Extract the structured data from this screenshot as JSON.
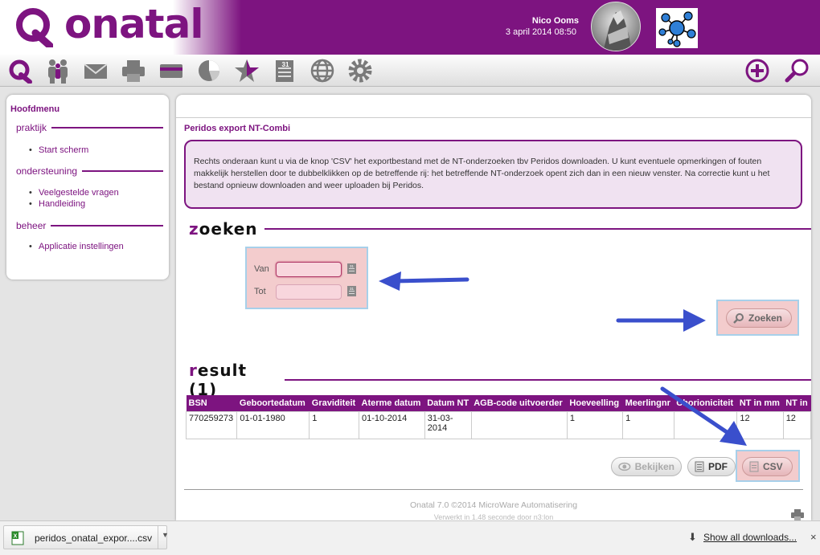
{
  "header": {
    "logo_text": "onatal",
    "user_name": "Nico Ooms",
    "datetime": "3 april 2014 08:50"
  },
  "toolbar": {
    "icons": [
      "onatal-home-icon",
      "patients-icon",
      "mail-icon",
      "print-icon",
      "card-icon",
      "chart-icon",
      "favorites-icon",
      "calendar-icon",
      "globe-icon",
      "settings-icon",
      "add-icon",
      "search-icon"
    ],
    "calendar_day": "31"
  },
  "sidebar": {
    "title": "Hoofdmenu",
    "sections": [
      {
        "label": "praktijk",
        "items": [
          "Start scherm"
        ]
      },
      {
        "label": "ondersteuning",
        "items": [
          "Veelgestelde vragen",
          "Handleiding"
        ]
      },
      {
        "label": "beheer",
        "items": [
          "Applicatie instellingen"
        ]
      }
    ]
  },
  "main": {
    "title": "Peridos export NT-Combi",
    "info": "Rechts onderaan kunt u via de knop 'CSV' het exportbestand met de NT-onderzoeken tbv Peridos downloaden. U kunt eventuele opmerkingen of fouten makkelijk herstellen door te dubbelklikken op de betreffende rij: het betreffende NT-onderzoek opent zich dan in een nieuw venster. Na correctie kunt u het bestand opnieuw downloaden and weer uploaden bij Peridos."
  },
  "search": {
    "heading_first": "z",
    "heading_rest": "oeken",
    "van_label": "Van",
    "tot_label": "Tot",
    "van_value": "",
    "tot_value": "",
    "button": "Zoeken"
  },
  "result": {
    "heading_first": "r",
    "heading_rest": "esult (1)",
    "columns": [
      "BSN",
      "Geboortedatum",
      "Graviditeit",
      "Aterme datum",
      "Datum NT",
      "AGB-code uitvoerder",
      "Hoeveelling",
      "Meerlingnr",
      "Chorioniciteit",
      "NT in mm",
      "NT in"
    ],
    "rows": [
      [
        "770259273",
        "01-01-1980",
        "1",
        "01-10-2014",
        "31-03-2014",
        "",
        "1",
        "1",
        "",
        "12",
        "12"
      ]
    ]
  },
  "actions": {
    "bekijken": "Bekijken",
    "pdf": "PDF",
    "csv": "CSV"
  },
  "footer": {
    "line1": "Onatal 7.0 ©2014 MicroWare Automatisering",
    "line2": "Verwerkt in 1.48 seconde door n3:lon"
  },
  "downloads": {
    "file_name": "peridos_onatal_expor....csv",
    "show_all": "Show all downloads...",
    "close": "×"
  },
  "colors": {
    "brand": "#7d1480",
    "highlight": "#f3cccd",
    "outline": "#a7d0ea",
    "arrow": "#3a4fcc"
  }
}
